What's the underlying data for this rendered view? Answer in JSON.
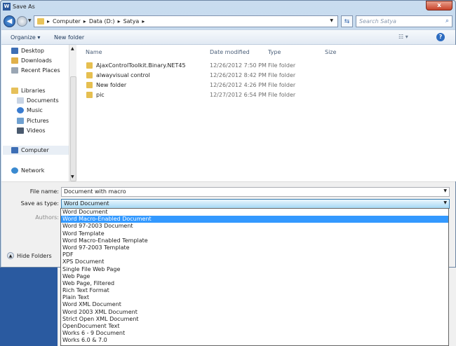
{
  "window": {
    "title": "Save As",
    "close_label": "x"
  },
  "address": {
    "crumbs": [
      "Computer",
      "Data (D:)",
      "Satya"
    ],
    "search_placeholder": "Search Satya"
  },
  "toolbar": {
    "organize": "Organize ▾",
    "new_folder": "New folder"
  },
  "nav": {
    "items": [
      {
        "label": "Desktop",
        "color": "#3d6eb5"
      },
      {
        "label": "Downloads",
        "color": "#e0b04a"
      },
      {
        "label": "Recent Places",
        "color": "#9aa6b4"
      },
      {
        "label": "Libraries",
        "color": "#e6c05a"
      },
      {
        "label": "Documents",
        "color": "#c8d4e4"
      },
      {
        "label": "Music",
        "color": "#3a7cd0"
      },
      {
        "label": "Pictures",
        "color": "#6fa0d0"
      },
      {
        "label": "Videos",
        "color": "#4a5a6e"
      },
      {
        "label": "Computer",
        "color": "#3d6eb5"
      },
      {
        "label": "Network",
        "color": "#3a8ad0"
      }
    ]
  },
  "columns": {
    "name": "Name",
    "date": "Date modified",
    "type": "Type",
    "size": "Size"
  },
  "files": [
    {
      "name": "AjaxControlToolkit.Binary.NET45",
      "date": "12/26/2012 7:50 PM",
      "type": "File folder"
    },
    {
      "name": "alwayvisual control",
      "date": "12/26/2012 8:42 PM",
      "type": "File folder"
    },
    {
      "name": "New folder",
      "date": "12/26/2012 4:26 PM",
      "type": "File folder"
    },
    {
      "name": "pic",
      "date": "12/27/2012 6:54 PM",
      "type": "File folder"
    }
  ],
  "form": {
    "file_name_label": "File name:",
    "file_name_value": "Document with macro",
    "save_type_label": "Save as type:",
    "save_type_value": "Word Document",
    "authors_label": "Authors:",
    "hide_folders": "Hide Folders"
  },
  "save_types": [
    "Word Document",
    "Word Macro-Enabled Document",
    "Word 97-2003 Document",
    "Word Template",
    "Word Macro-Enabled Template",
    "Word 97-2003 Template",
    "PDF",
    "XPS Document",
    "Single File Web Page",
    "Web Page",
    "Web Page, Filtered",
    "Rich Text Format",
    "Plain Text",
    "Word XML Document",
    "Word 2003 XML Document",
    "Strict Open XML Document",
    "OpenDocument Text",
    "Works 6 - 9 Document",
    "Works 6.0 & 7.0"
  ],
  "highlighted_type_index": 1
}
